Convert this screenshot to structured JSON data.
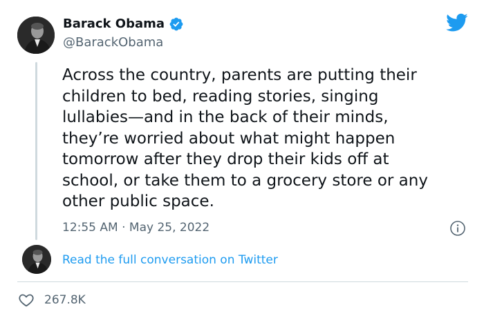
{
  "tweet": {
    "author": {
      "display_name": "Barack Obama",
      "handle": "@BarackObama",
      "verified": true,
      "avatar_icon": "profile-photo"
    },
    "text": "Across the country, parents are putting their\nchildren to bed, reading stories, singing\nlullabies—and in the back of their minds,\nthey’re worried about what might happen\ntomorrow after they drop their kids off at\nschool, or take them to a grocery store or any\nother public space.",
    "timestamp": "12:55 AM · May 25, 2022",
    "read_more_link": "Read the full conversation on Twitter",
    "likes": "267.8K"
  },
  "colors": {
    "twitter_blue": "#1d9bf0",
    "text_primary": "#0f1419",
    "text_secondary": "#536471",
    "divider": "#cfd9de"
  },
  "icons": {
    "brand": "twitter-bird-icon",
    "verified": "verified-badge-icon",
    "info": "info-icon",
    "like": "heart-icon"
  }
}
